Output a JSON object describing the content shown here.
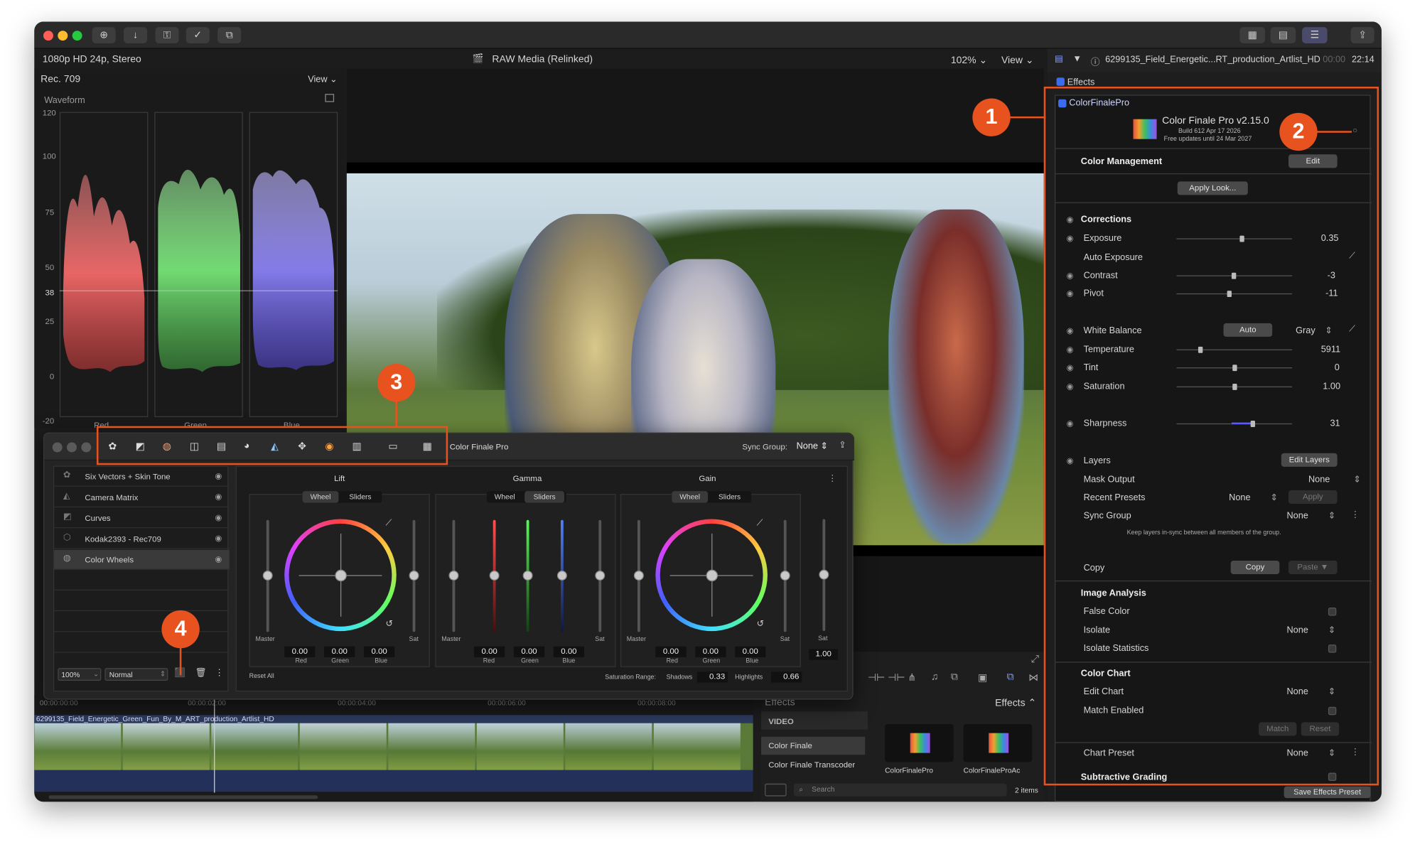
{
  "topbar": {
    "left": "1080p HD 24p, Stereo",
    "center": "RAW Media (Relinked)",
    "zoom": "102%",
    "view": "View",
    "clip": "6299135_Field_Energetic...RT_production_Artlist_HD",
    "timecode_dim": "00:00",
    "timecode": "22:14"
  },
  "scope": {
    "colorspace": "Rec. 709",
    "view": "View",
    "name": "Waveform",
    "scale": [
      "120",
      "100",
      "75",
      "50",
      "38",
      "25",
      "0",
      "-20"
    ],
    "channels": [
      "Red",
      "Green",
      "Blue"
    ]
  },
  "callouts": [
    "1",
    "2",
    "3",
    "4"
  ],
  "inspector": {
    "section": "Effects",
    "plugin": "ColorFinalePro",
    "product": "Color Finale Pro v2.15.0",
    "build": "Build 612 Apr 17 2026",
    "updates": "Free updates until 24 Mar 2027",
    "color_management": "Color Management",
    "edit": "Edit",
    "apply_look": "Apply Look...",
    "corrections": "Corrections",
    "rows": [
      {
        "label": "Exposure",
        "value": "0.35",
        "pos": 0.56
      },
      {
        "label": "Auto Exposure"
      },
      {
        "label": "Contrast",
        "value": "-3",
        "pos": 0.49
      },
      {
        "label": "Pivot",
        "value": "-11",
        "pos": 0.45
      }
    ],
    "white_balance": "White Balance",
    "auto": "Auto",
    "gray": "Gray",
    "wb_rows": [
      {
        "label": "Temperature",
        "value": "5911",
        "pos": 0.2
      },
      {
        "label": "Tint",
        "value": "0",
        "pos": 0.5
      },
      {
        "label": "Saturation",
        "value": "1.00",
        "pos": 0.5
      }
    ],
    "sharpness": {
      "label": "Sharpness",
      "value": "31",
      "pos": 0.66
    },
    "layers": "Layers",
    "edit_layers": "Edit Layers",
    "mask_output": "Mask Output",
    "mask_val": "None",
    "recent_presets": "Recent Presets",
    "recent_val": "None",
    "apply": "Apply",
    "sync_group": "Sync Group",
    "sync_val": "None",
    "sync_note": "Keep layers in-sync between all members of the group.",
    "copy_label": "Copy",
    "copy_btn": "Copy",
    "paste": "Paste",
    "image_analysis": "Image Analysis",
    "false_color": "False Color",
    "isolate": "Isolate",
    "isolate_val": "None",
    "isolate_stats": "Isolate Statistics",
    "color_chart": "Color Chart",
    "edit_chart": "Edit Chart",
    "edit_chart_val": "None",
    "match_enabled": "Match Enabled",
    "match": "Match",
    "reset": "Reset",
    "chart_preset": "Chart Preset",
    "chart_preset_val": "None",
    "subtractive": "Subtractive Grading",
    "save_preset": "Save Effects Preset"
  },
  "cf": {
    "title": "Color Finale Pro",
    "sync_group": "Sync Group:",
    "sync_val": "None",
    "layers": [
      "Six Vectors + Skin Tone",
      "Camera Matrix",
      "Curves",
      "Kodak2393 - Rec709",
      "Color Wheels"
    ],
    "zoom": "100%",
    "blend": "Normal",
    "lift": "Lift",
    "gamma": "Gamma",
    "gain": "Gain",
    "wheel": "Wheel",
    "sliders": "Sliders",
    "master": "Master",
    "sat": "Sat",
    "red": "Red",
    "green": "Green",
    "blue": "Blue",
    "lift_vals": [
      "0.00",
      "0.00",
      "0.00"
    ],
    "gamma_vals": [
      "0.00",
      "0.00",
      "0.00"
    ],
    "gain_vals": [
      "0.00",
      "0.00",
      "0.00"
    ],
    "sat_val": "1.00",
    "reset_all": "Reset All",
    "sat_range": "Saturation Range:",
    "shadows": "Shadows",
    "shadows_val": "0.33",
    "highlights": "Highlights",
    "highlights_val": "0.66"
  },
  "timeline": {
    "clip": "6299135_Field_Energetic_Green_Fun_By_M_ART_production_Artlist_HD",
    "ticks": [
      "00:00:00:00",
      "00:00:02:00",
      "00:00:04:00",
      "00:00:06:00",
      "00:00:08:00"
    ]
  },
  "effects": {
    "title": "Effects",
    "header": "Effects",
    "video": "VIDEO",
    "items": [
      "Color Finale",
      "Color Finale Transcoder"
    ],
    "thumbs": [
      "ColorFinalePro",
      "ColorFinaleProAc"
    ],
    "search": "Search",
    "count": "2 items"
  },
  "colors": {
    "accent": "#e8521e",
    "waveform_red": "#ff6e6e",
    "waveform_green": "#7cf07c",
    "waveform_blue": "#8f86ff"
  }
}
